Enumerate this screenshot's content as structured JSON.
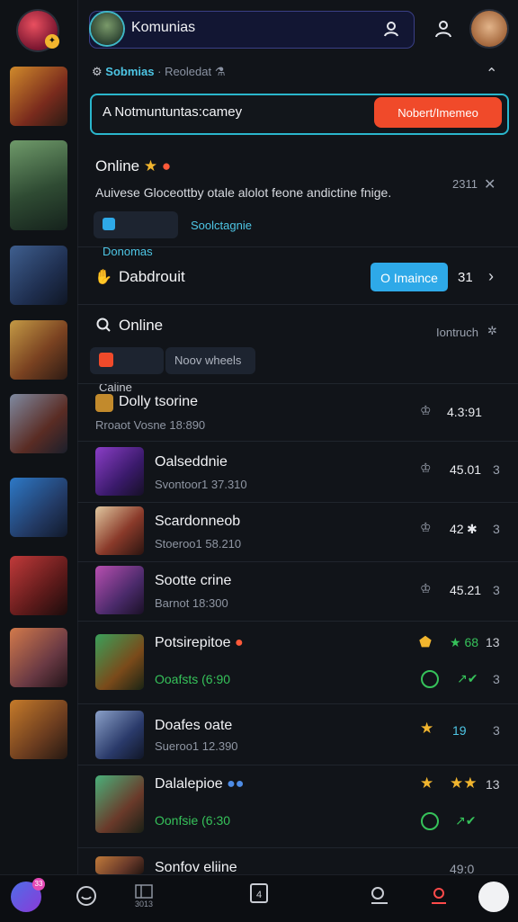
{
  "header": {
    "search_text": "Komunias",
    "breadcrumb_primary": "Sobmias",
    "breadcrumb_sep": "·",
    "breadcrumb_secondary": "Reoledat"
  },
  "community_box": {
    "input_text": "A Notmuntuntas:camey",
    "button_label": "Nobert/Imemeo"
  },
  "online_section": {
    "title": "Online",
    "description": "Auivese Gloceottby otale alolot feone andictine fnige.",
    "count": "2311",
    "chip_primary": "Donomas",
    "chip_secondary": "Soolctagnie"
  },
  "dabdrouit": {
    "title": "Dabdrouit",
    "button_label": "O Imaince",
    "count": "31"
  },
  "online2": {
    "title": "Online",
    "meta": "Iontruch",
    "tabs": [
      "Caline",
      "Noov wheels"
    ]
  },
  "rows": [
    {
      "title": "Dolly tsorine",
      "meta": "Rroaot Vosne 18:890",
      "value": "4.3:91",
      "num": "",
      "icon": "crown-outline-icon"
    },
    {
      "title": "Oalseddnie",
      "meta": "Svontoor1 37.310",
      "value": "45.01",
      "num": "3",
      "icon": "crown-outline-icon"
    },
    {
      "title": "Scardonneob",
      "meta": "Stoeroo1 58.210",
      "value": "42",
      "num": "3",
      "icon": "crown-outline-icon"
    },
    {
      "title": "Sootte crine",
      "meta": "Barnot 18:300",
      "value": "45.21",
      "num": "3",
      "icon": "crown-outline-icon"
    },
    {
      "title": "Potsirepitoe",
      "meta": "Ooafsts (6:90",
      "value": "68",
      "num": "13",
      "num2": "3",
      "icon": "gem-icon"
    },
    {
      "title": "Doafes oate",
      "meta": "Sueroo1 12.390",
      "value": "19",
      "num": "3",
      "icon": "star-icon"
    },
    {
      "title": "Dalalepioe",
      "meta": "Oonfsie (6:30",
      "value": "",
      "num": "13",
      "num2": "3",
      "icon": "star-icon"
    },
    {
      "title": "Sonfov eliine",
      "meta": "",
      "value": "49:0",
      "num": "",
      "icon": "star-icon"
    }
  ],
  "bottom_nav": {
    "badge": "33",
    "label_2": "3013",
    "label_4": "4"
  },
  "colors": {
    "accent_cyan": "#2ab6cc",
    "accent_orange": "#f04a2a",
    "accent_blue": "#2ea9e8",
    "accent_green": "#36c25a",
    "gold": "#f1b52e"
  }
}
